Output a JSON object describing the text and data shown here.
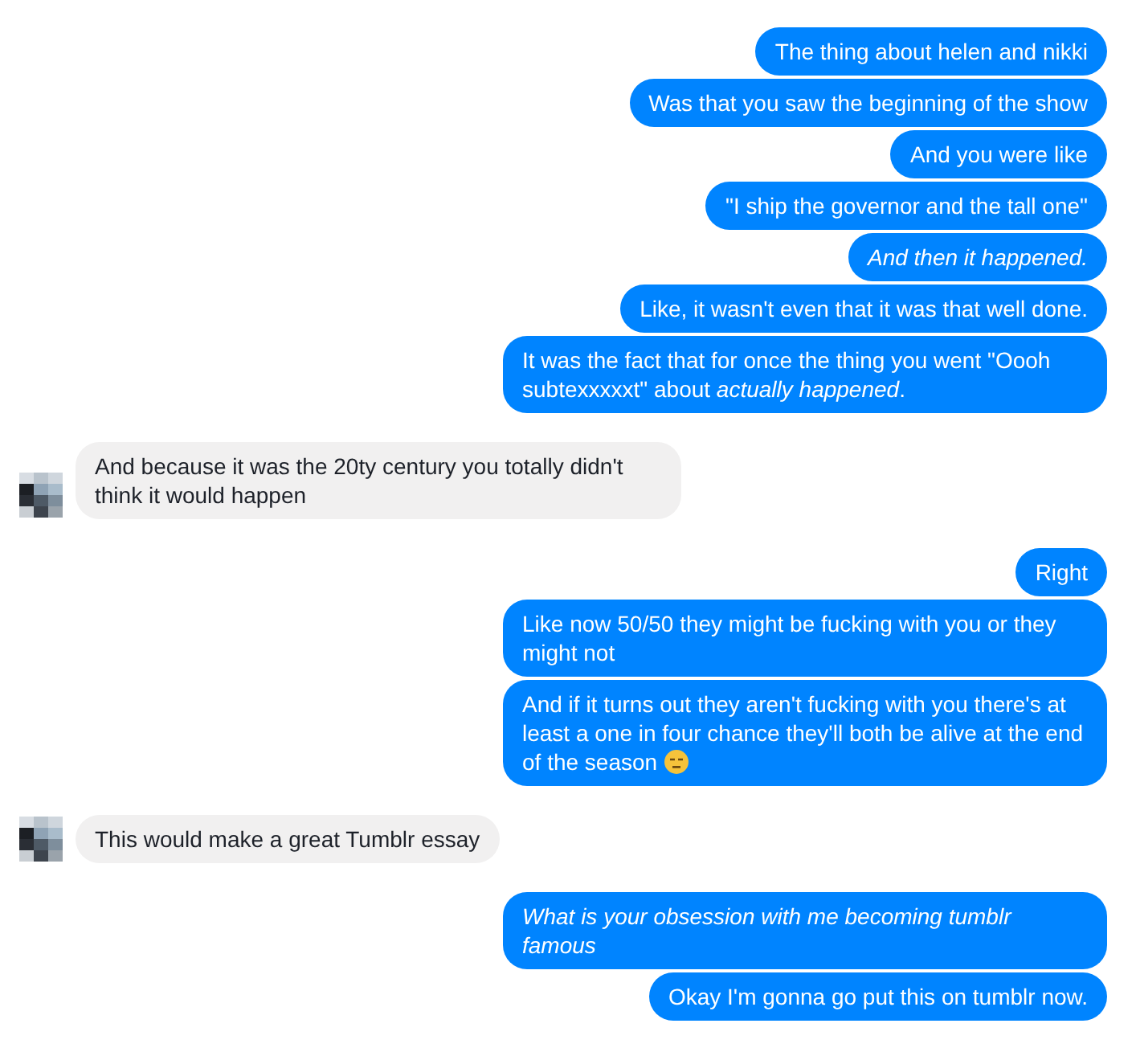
{
  "groups": [
    {
      "kind": "sent",
      "messages": [
        {
          "text": "The thing about helen and nikki",
          "italic": false
        },
        {
          "text": "Was that you saw the beginning of the show",
          "italic": false
        },
        {
          "text": "And you were like",
          "italic": false
        },
        {
          "text": "\"I ship the governor and the tall one\"",
          "italic": false
        },
        {
          "text": "And then it happened.",
          "italic": true
        },
        {
          "text": "Like, it wasn't even that it was that well done.",
          "italic": false
        },
        {
          "text": "It was the fact that for once the thing you went \"Oooh subtexxxxxt\" about *actually happened*.",
          "italic": false
        }
      ]
    },
    {
      "kind": "received",
      "messages": [
        {
          "text": "And because it was the 20ty century you totally didn't think it would happen",
          "italic": false
        }
      ]
    },
    {
      "kind": "sent",
      "messages": [
        {
          "text": "Right",
          "italic": false
        },
        {
          "text": "Like now 50/50 they might be fucking with you or they might not",
          "italic": false
        },
        {
          "text": "And if it turns out they aren't fucking with you there's at least a one in four chance they'll both be alive at the end of the season",
          "italic": false,
          "emoji": true
        }
      ]
    },
    {
      "kind": "received",
      "messages": [
        {
          "text": "This would make a great Tumblr essay",
          "italic": false
        }
      ]
    },
    {
      "kind": "sent",
      "messages": [
        {
          "text": "What is your obsession with me becoming tumblr famous",
          "italic": true
        },
        {
          "text": "Okay I'm gonna go put this on tumblr now.",
          "italic": false
        }
      ]
    }
  ]
}
